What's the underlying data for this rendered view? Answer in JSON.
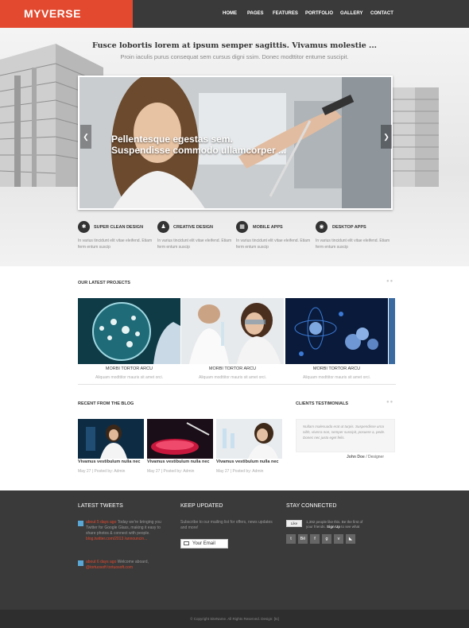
{
  "brand": {
    "logo": "MYVERSE"
  },
  "nav": [
    {
      "label": "HOME"
    },
    {
      "label": "PAGES"
    },
    {
      "label": "FEATURES"
    },
    {
      "label": "PORTFOLIO"
    },
    {
      "label": "GALLERY"
    },
    {
      "label": "CONTACT"
    }
  ],
  "hero": {
    "title": "Fusce lobortis lorem at ipsum semper sagittis. Vivamus molestie ...",
    "subtitle": "Proin iaculis purus consequat sem cursus digni ssim. Donec modttitor entume suscipit.",
    "slide_caption_line1": "Pellentesque egestas sem.",
    "slide_caption_line2": "Suspendisse commodo ullamcorper ..."
  },
  "features": [
    {
      "icon": "gear-icon",
      "glyph": "✱",
      "title": "SUPER CLEAN DESIGN",
      "text": "In varius tincidunt elit vitae eleifend. Etiam ferm entum suscip"
    },
    {
      "icon": "person-icon",
      "glyph": "♟",
      "title": "CREATIVE DESIGN",
      "text": "In varius tincidunt elit vitae eleifend. Etiam ferm entum suscip"
    },
    {
      "icon": "grid-icon",
      "glyph": "▦",
      "title": "MOBILE APPS",
      "text": "In varius tincidunt elit vitae eleifend. Etiam ferm entum suscip"
    },
    {
      "icon": "globe-icon",
      "glyph": "◉",
      "title": "DESKTOP APPS",
      "text": "In varius tincidunt elit vitae eleifend. Etiam ferm entum suscip"
    }
  ],
  "projects": {
    "heading": "OUR LATEST PROJECTS",
    "items": [
      {
        "title": "MORBI TORTOR ARCU",
        "text": "Aliquam modttitor mauris sit amet orci."
      },
      {
        "title": "MORBI TORTOR ARCU",
        "text": "Aliquam modttitor mauris sit amet orci."
      },
      {
        "title": "MORBI TORTOR ARCU",
        "text": "Aliquam modttitor mauris sit amet orci."
      }
    ]
  },
  "blog": {
    "heading": "RECENT FROM THE BLOG",
    "items": [
      {
        "title": "Vivamus vestibulum nulla nec",
        "meta": "May 27 | Posted by: Admin"
      },
      {
        "title": "Vivamus vestibulum nulla nec",
        "meta": "May 27 | Posted by: Admin"
      },
      {
        "title": "Vivamus vestibulum nulla nec",
        "meta": "May 27 | Posted by: Admin"
      }
    ]
  },
  "testimonials": {
    "heading": "CLIENTS TESTIMONIALS",
    "quote": "Nullam malesuada erat ut turpis. Suspendisse urna nibh, viverra non, semper suscipit, posuere a, pede. Donec nec justo eget felis.",
    "author": "John Doe",
    "role": "/ Designer"
  },
  "footer": {
    "tweets_heading": "LATEST TWEETS",
    "tweets": [
      {
        "when": "about 5 days ago",
        "text": "Today we're bringing you Twitter for Google Glass, making it easy to share photos & connect with people.",
        "link": "blog.twitter.com/2013 /announcin..."
      },
      {
        "when": "about 6 days ago",
        "text": "Welcome aboard,",
        "link": "@tortuosoft tortuosoft.com"
      }
    ],
    "updated_heading": "KEEP UPDATED",
    "updated_text": "Subscribe to our mailing list for offers, news updates and more!",
    "email_placeholder": "Your Email",
    "connected_heading": "STAY CONNECTED",
    "like_label": "Like",
    "like_text": "1,392 people like this. Be the first of your friends.",
    "signup_label": "Sign Up",
    "like_tail": "to see what",
    "social": [
      {
        "icon": "twitter-icon",
        "glyph": "t"
      },
      {
        "icon": "behance-icon",
        "glyph": "Bē"
      },
      {
        "icon": "facebook-icon",
        "glyph": "f"
      },
      {
        "icon": "google-plus-icon",
        "glyph": "g"
      },
      {
        "icon": "vimeo-icon",
        "glyph": "v"
      },
      {
        "icon": "rss-icon",
        "glyph": "◣"
      }
    ],
    "copyright": "© Copyright SiteName. All Rights Reserved. Design: [ts]"
  },
  "colors": {
    "accent": "#e2492f",
    "dark": "#3a3a3a",
    "footer_bottom": "#2e2e2e"
  }
}
